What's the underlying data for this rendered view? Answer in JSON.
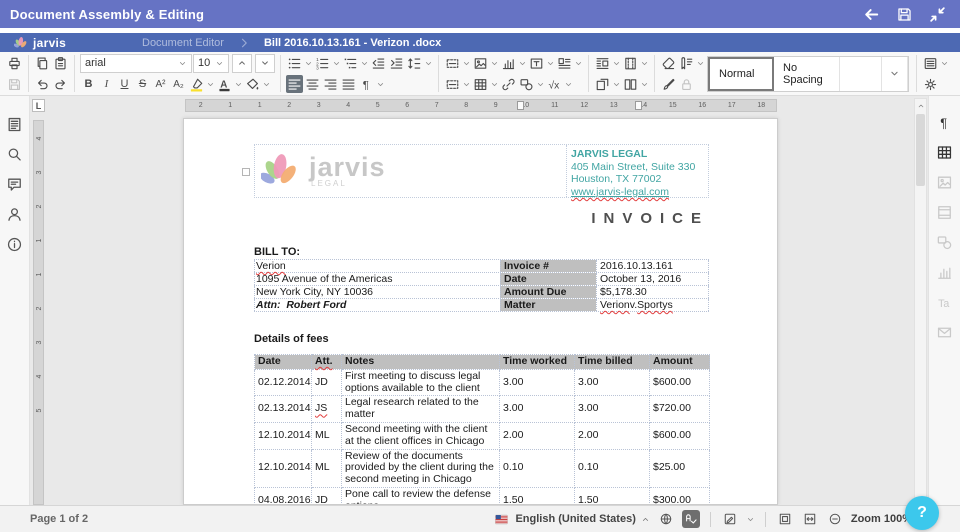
{
  "header": {
    "title": "Document Assembly & Editing"
  },
  "tabbar": {
    "brand": "jarvis",
    "document_editor_tab": "Document Editor",
    "file_tab": "Bill 2016.10.13.161 - Verizon .docx"
  },
  "toolbar": {
    "font_name": "arial",
    "font_size": "10",
    "format": {
      "bold": "B",
      "italic": "I",
      "underline": "U",
      "strikethrough": "S",
      "superscript": "A²",
      "subscript": "A₂"
    },
    "styles": [
      "Normal",
      "No Spacing",
      ""
    ]
  },
  "left_sidebar": {
    "icons": [
      "thumbnails",
      "search",
      "comment",
      "user",
      "info"
    ]
  },
  "right_sidebar": {
    "icons": [
      {
        "name": "pilcrow",
        "enabled": true
      },
      {
        "name": "table",
        "enabled": true
      },
      {
        "name": "image",
        "enabled": false
      },
      {
        "name": "header-footer",
        "enabled": false
      },
      {
        "name": "shape",
        "enabled": false
      },
      {
        "name": "chart",
        "enabled": false
      },
      {
        "name": "text-art",
        "enabled": false
      },
      {
        "name": "mailmerge",
        "enabled": false
      }
    ]
  },
  "ruler": {
    "horizontal": [
      "2",
      "1",
      "1",
      "2",
      "3",
      "4",
      "5",
      "6",
      "7",
      "8",
      "9",
      "10",
      "11",
      "12",
      "13",
      "14",
      "15",
      "16",
      "17",
      "18"
    ],
    "vertical": [
      "4",
      "3",
      "2",
      "1",
      "1",
      "2",
      "3",
      "4",
      "5"
    ]
  },
  "document": {
    "logo": {
      "text": "jarvis",
      "subtext": "LEGAL"
    },
    "company": {
      "name": "JARVIS LEGAL",
      "address_line1": "405 Main Street, Suite 330",
      "address_line2": "Houston, TX 77002",
      "website": "www.jarvis-legal.com"
    },
    "invoice_title": "INVOICE",
    "bill_to": {
      "label": "BILL TO:",
      "client": "Verion",
      "address_line1": "1095 Avenue of the Americas",
      "address_line2": "New York City, NY 10036",
      "attn": "Attn:  Robert Ford"
    },
    "invoice_info": [
      {
        "label": "Invoice #",
        "value": "2016.10.13.161"
      },
      {
        "label": "Date",
        "value": "October 13, 2016"
      },
      {
        "label": "Amount Due",
        "value": "$5,178.30"
      },
      {
        "label": "Matter",
        "value": "Verion v. Sportys"
      }
    ],
    "fees": {
      "heading": "Details of fees",
      "columns": [
        "Date",
        "Att.",
        "Notes",
        "Time worked",
        "Time billed",
        "Amount"
      ],
      "rows": [
        [
          "02.12.2014",
          "JD",
          "First meeting to discuss legal options available to the client",
          "3.00",
          "3.00",
          "$600.00"
        ],
        [
          "02.13.2014",
          "JS",
          "Legal research related to the matter",
          "3.00",
          "3.00",
          "$720.00"
        ],
        [
          "12.10.2014",
          "ML",
          "Second meeting with the client at the client offices in Chicago",
          "2.00",
          "2.00",
          "$600.00"
        ],
        [
          "12.10.2014",
          "ML",
          "Review of the documents provided by the client during the second meeting in Chicago",
          "0.10",
          "0.10",
          "$25.00"
        ],
        [
          "04.08.2016",
          "JD",
          "Pone call to review the defense options",
          "1.50",
          "1.50",
          "$300.00"
        ]
      ]
    },
    "misspelled": [
      "Verion",
      "Sportys",
      "JS",
      "Att.",
      "www.jarvis-legal.com"
    ]
  },
  "statusbar": {
    "page_label": "Page 1 of 2",
    "language": "English (United States)",
    "zoom_label": "Zoom 100%",
    "help_label": "?"
  },
  "colors": {
    "header_purple": "#6673c4",
    "tab_blue": "#4d69b3",
    "accent_teal": "#41a5a3",
    "label_gray": "#bfbfbf",
    "help_cyan": "#3cc8ec",
    "highlight_yellow": "#f9e02e",
    "squiggle_red": "#e23b3b"
  }
}
